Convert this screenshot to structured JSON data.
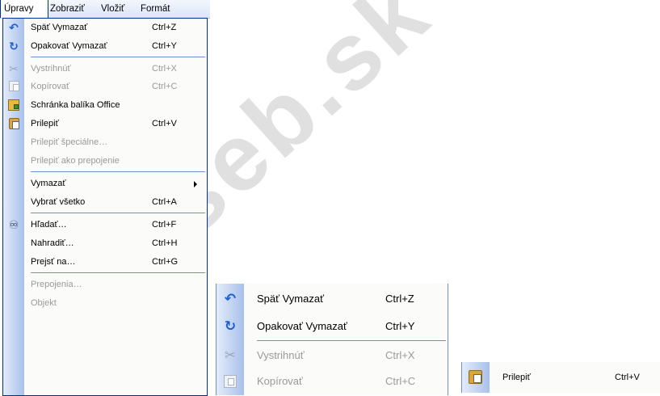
{
  "menubar": {
    "items": [
      {
        "label": "Úpravy"
      },
      {
        "label": "Zobraziť"
      },
      {
        "label": "Vložiť"
      },
      {
        "label": "Formát"
      }
    ]
  },
  "menu": {
    "items": [
      {
        "label": "Späť Vymazať",
        "shortcut": "Ctrl+Z",
        "icon": "undo-icon",
        "enabled": true
      },
      {
        "label": "Opakovať Vymazať",
        "shortcut": "Ctrl+Y",
        "icon": "redo-icon",
        "enabled": true
      },
      {
        "label": "Vystrihnúť",
        "shortcut": "Ctrl+X",
        "icon": "scissors-icon",
        "enabled": false
      },
      {
        "label": "Kopírovať",
        "shortcut": "Ctrl+C",
        "icon": "copy-icon",
        "enabled": false
      },
      {
        "label": "Schránka balíka Office",
        "shortcut": "",
        "icon": "office-clipboard-icon",
        "enabled": true
      },
      {
        "label": "Prilepiť",
        "shortcut": "Ctrl+V",
        "icon": "paste-icon",
        "enabled": true
      },
      {
        "label": "Prilepiť špeciálne…",
        "shortcut": "",
        "enabled": false
      },
      {
        "label": "Prilepiť ako prepojenie",
        "shortcut": "",
        "enabled": false
      },
      {
        "label": "Vymazať",
        "shortcut": "",
        "submenu": true,
        "enabled": true
      },
      {
        "label": "Vybrať všetko",
        "shortcut": "Ctrl+A",
        "enabled": true
      },
      {
        "label": "Hľadať…",
        "shortcut": "Ctrl+F",
        "icon": "binoculars-icon",
        "enabled": true
      },
      {
        "label": "Nahradiť…",
        "shortcut": "Ctrl+H",
        "enabled": true
      },
      {
        "label": "Prejsť na…",
        "shortcut": "Ctrl+G",
        "enabled": true
      },
      {
        "label": "Prepojenia…",
        "shortcut": "",
        "enabled": false
      },
      {
        "label": "Objekt",
        "shortcut": "",
        "enabled": false
      }
    ]
  },
  "zoom_menu": {
    "items": [
      {
        "label": "Späť Vymazať",
        "shortcut": "Ctrl+Z"
      },
      {
        "label": "Opakovať Vymazať",
        "shortcut": "Ctrl+Y"
      },
      {
        "label": "Vystrihnúť",
        "shortcut": "Ctrl+X"
      },
      {
        "label": "Kopírovať",
        "shortcut": "Ctrl+C"
      }
    ]
  },
  "single_item": {
    "label": "Prilepiť",
    "shortcut": "Ctrl+V"
  },
  "watermark": "zseb.sk",
  "colors": {
    "accent": "#002d96",
    "strip_start": "#e3ecfb",
    "strip_end": "#a8c0ea",
    "disabled": "#9a9a9a"
  }
}
